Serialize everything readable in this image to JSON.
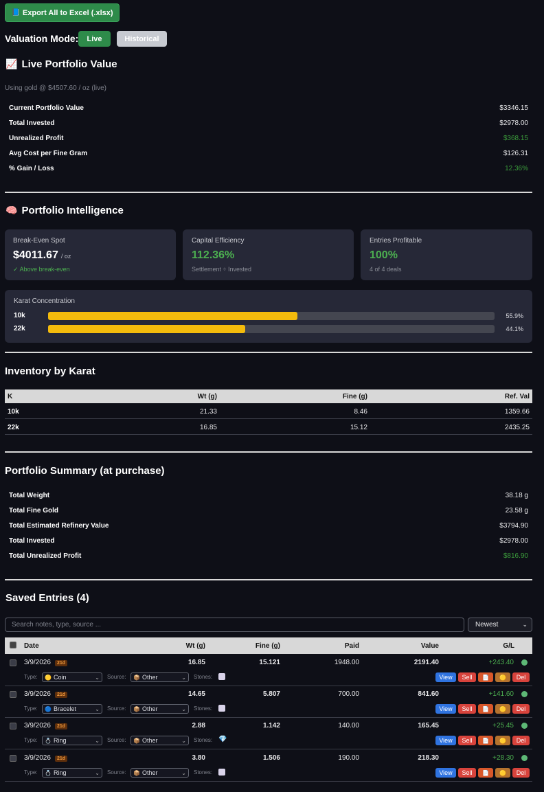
{
  "toolbar": {
    "export_label": "Export All to Excel (.xlsx)",
    "export_icon": "book-icon"
  },
  "valuation": {
    "label": "Valuation Mode:",
    "live": "Live",
    "historical": "Historical"
  },
  "live": {
    "title": "Live Portfolio Value",
    "title_icon": "chart-icon",
    "gold_note": "Using gold @ $4507.60 / oz (live)",
    "rows": [
      {
        "label": "Current Portfolio Value",
        "value": "$3346.15"
      },
      {
        "label": "Total Invested",
        "value": "$2978.00"
      },
      {
        "label": "Unrealized Profit",
        "value": "$368.15"
      },
      {
        "label": "Avg Cost per Fine Gram",
        "value": "$126.31"
      },
      {
        "label": "% Gain / Loss",
        "value": "12.36%"
      }
    ]
  },
  "intel": {
    "title": "Portfolio Intelligence",
    "title_icon": "brain-icon",
    "breakeven": {
      "title": "Break-Even Spot",
      "value": "$4011.67",
      "unit": "/ oz",
      "sub": "✓ Above break-even"
    },
    "efficiency": {
      "title": "Capital Efficiency",
      "value": "112.36%",
      "sub": "Settlement ÷ Invested"
    },
    "profitable": {
      "title": "Entries Profitable",
      "value": "100%",
      "sub": "4 of 4 deals"
    },
    "karat": {
      "title": "Karat Concentration",
      "bars": [
        {
          "label": "10k",
          "pct_text": "55.9%",
          "pct": 55.9
        },
        {
          "label": "22k",
          "pct_text": "44.1%",
          "pct": 44.1
        }
      ]
    }
  },
  "inventory": {
    "title": "Inventory by Karat",
    "headers": [
      "K",
      "Wt (g)",
      "Fine (g)",
      "Ref. Val"
    ],
    "rows": [
      [
        "10k",
        "21.33",
        "8.46",
        "1359.66"
      ],
      [
        "22k",
        "16.85",
        "15.12",
        "2435.25"
      ]
    ]
  },
  "summary": {
    "title": "Portfolio Summary (at purchase)",
    "rows": [
      {
        "label": "Total Weight",
        "value": "38.18 g"
      },
      {
        "label": "Total Fine Gold",
        "value": "23.58 g"
      },
      {
        "label": "Total Estimated Refinery Value",
        "value": "$3794.90"
      },
      {
        "label": "Total Invested",
        "value": "$2978.00"
      },
      {
        "label": "Total Unrealized Profit",
        "value": "$816.90"
      }
    ]
  },
  "entries": {
    "title": "Saved Entries (4)",
    "search_placeholder": "Search notes, type, source ...",
    "sort": "Newest",
    "headers": [
      "Date",
      "Wt (g)",
      "Fine (g)",
      "Paid",
      "Value",
      "G/L"
    ],
    "type_label": "Type:",
    "source_label": "Source:",
    "stones_label": "Stones:",
    "actions": {
      "view": "View",
      "sell": "Sell",
      "doc": "doc-icon",
      "coin": "coin-icon",
      "del": "Del"
    },
    "rows": [
      {
        "date": "3/9/2026",
        "badge": "21d",
        "wt": "16.85",
        "fine": "15.121",
        "paid": "1948.00",
        "value": "2191.40",
        "gl": "+243.40",
        "type": "Coin",
        "type_icon": "coin-icon",
        "source": "Other",
        "stones_icon": "box-icon"
      },
      {
        "date": "3/9/2026",
        "badge": "21d",
        "wt": "14.65",
        "fine": "5.807",
        "paid": "700.00",
        "value": "841.60",
        "gl": "+141.60",
        "type": "Bracelet",
        "type_icon": "bracelet-icon",
        "source": "Other",
        "stones_icon": "box-icon"
      },
      {
        "date": "3/9/2026",
        "badge": "21d",
        "wt": "2.88",
        "fine": "1.142",
        "paid": "140.00",
        "value": "165.45",
        "gl": "+25.45",
        "type": "Ring",
        "type_icon": "ring-icon",
        "source": "Other",
        "stones_icon": "gem-icon"
      },
      {
        "date": "3/9/2026",
        "badge": "21d",
        "wt": "3.80",
        "fine": "1.506",
        "paid": "190.00",
        "value": "218.30",
        "gl": "+28.30",
        "type": "Ring",
        "type_icon": "ring-icon",
        "source": "Other",
        "stones_icon": "box-icon"
      }
    ]
  }
}
